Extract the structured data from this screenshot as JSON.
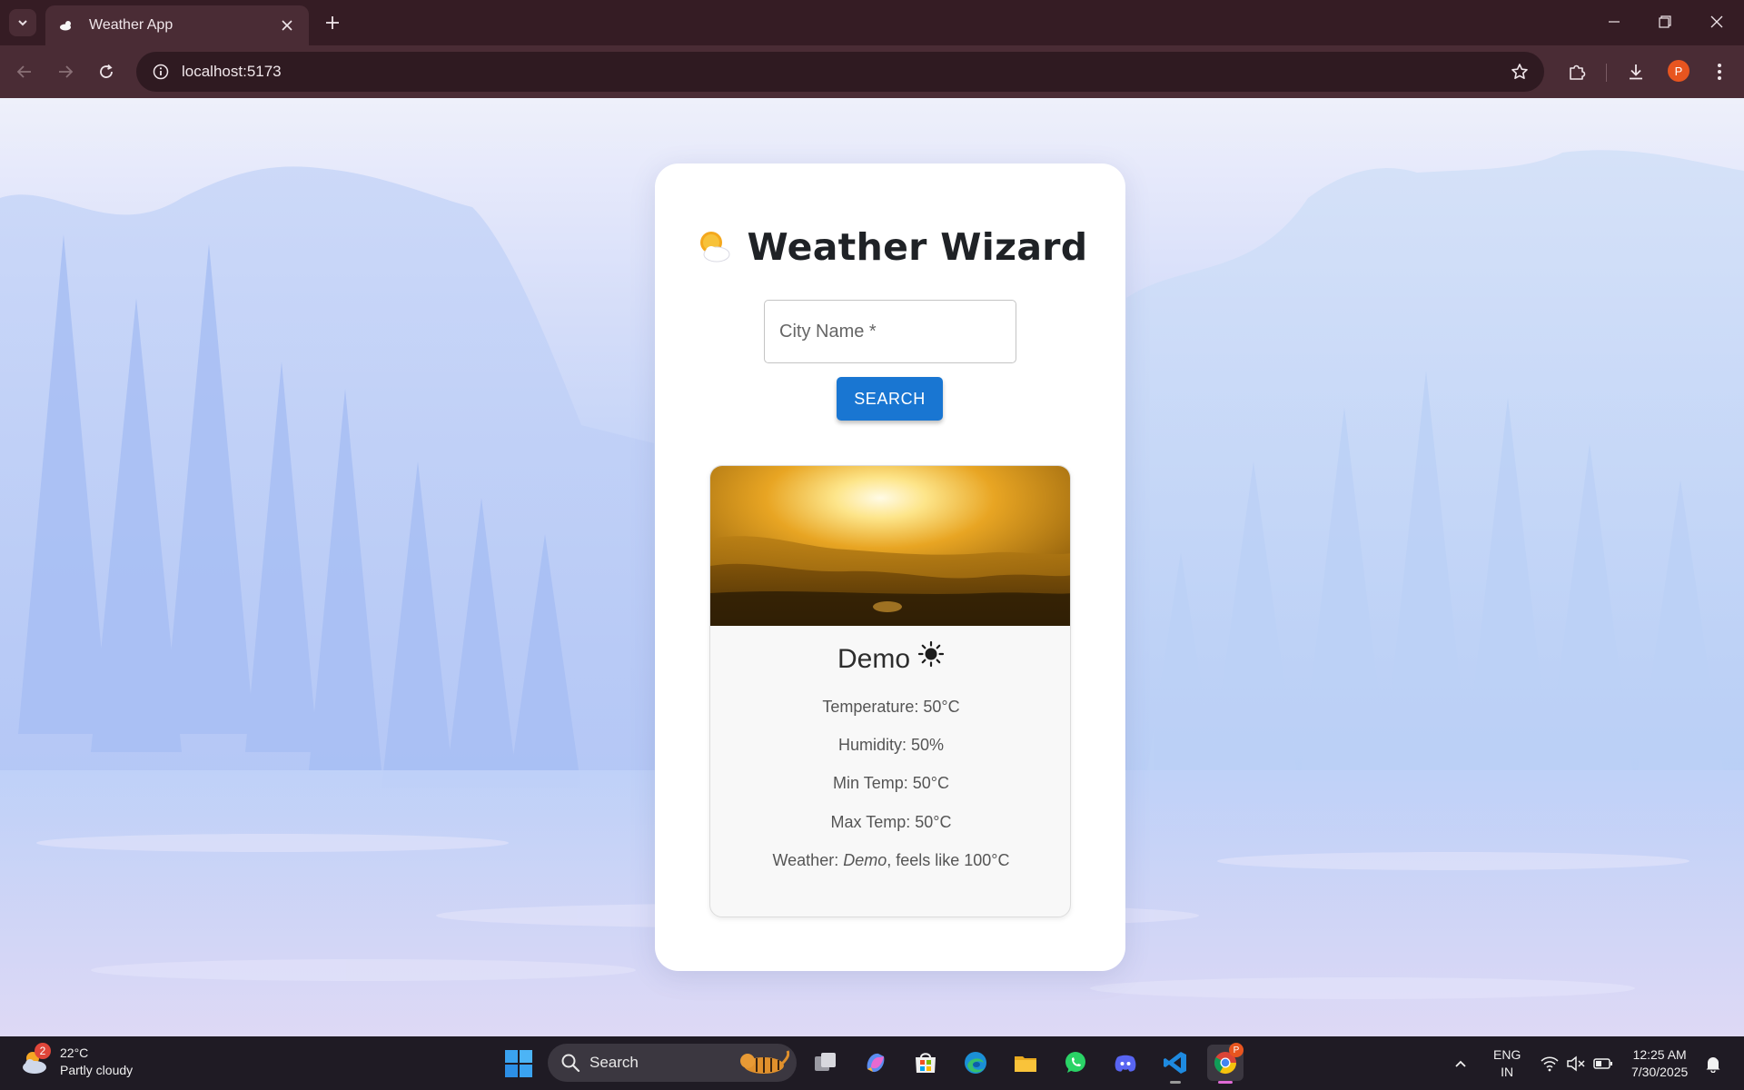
{
  "browser": {
    "tab_title": "Weather App",
    "url": "localhost:5173",
    "profile_initial": "P"
  },
  "app": {
    "title": "Weather Wizard",
    "city_placeholder": "City Name *",
    "search_label": "SEARCH"
  },
  "weather": {
    "city": "Demo",
    "temperature": "Temperature: 50°C",
    "humidity": "Humidity: 50%",
    "min_temp": "Min Temp: 50°C",
    "max_temp": "Max Temp: 50°C",
    "description_prefix": "Weather: ",
    "description_value": "Demo",
    "description_suffix": ", feels like 100°C"
  },
  "taskbar": {
    "weather_temp": "22°C",
    "weather_desc": "Partly cloudy",
    "weather_badge": "2",
    "search_label": "Search",
    "lang_line1": "ENG",
    "lang_line2": "IN",
    "time": "12:25 AM",
    "date": "7/30/2025",
    "chrome_badge": "P"
  },
  "colors": {
    "accent": "#1976d2",
    "browser_frame": "#351c24",
    "profile": "#e8551f"
  },
  "icons": [
    "tab-search-icon",
    "weather-app-favicon",
    "close-icon",
    "new-tab-icon",
    "minimize-icon",
    "restore-icon",
    "back-icon",
    "forward-icon",
    "reload-icon",
    "site-info-icon",
    "bookmark-star-icon",
    "extensions-icon",
    "download-icon",
    "menu-icon",
    "sun-cloud-icon",
    "sun-icon",
    "windows-start-icon",
    "search-icon"
  ]
}
